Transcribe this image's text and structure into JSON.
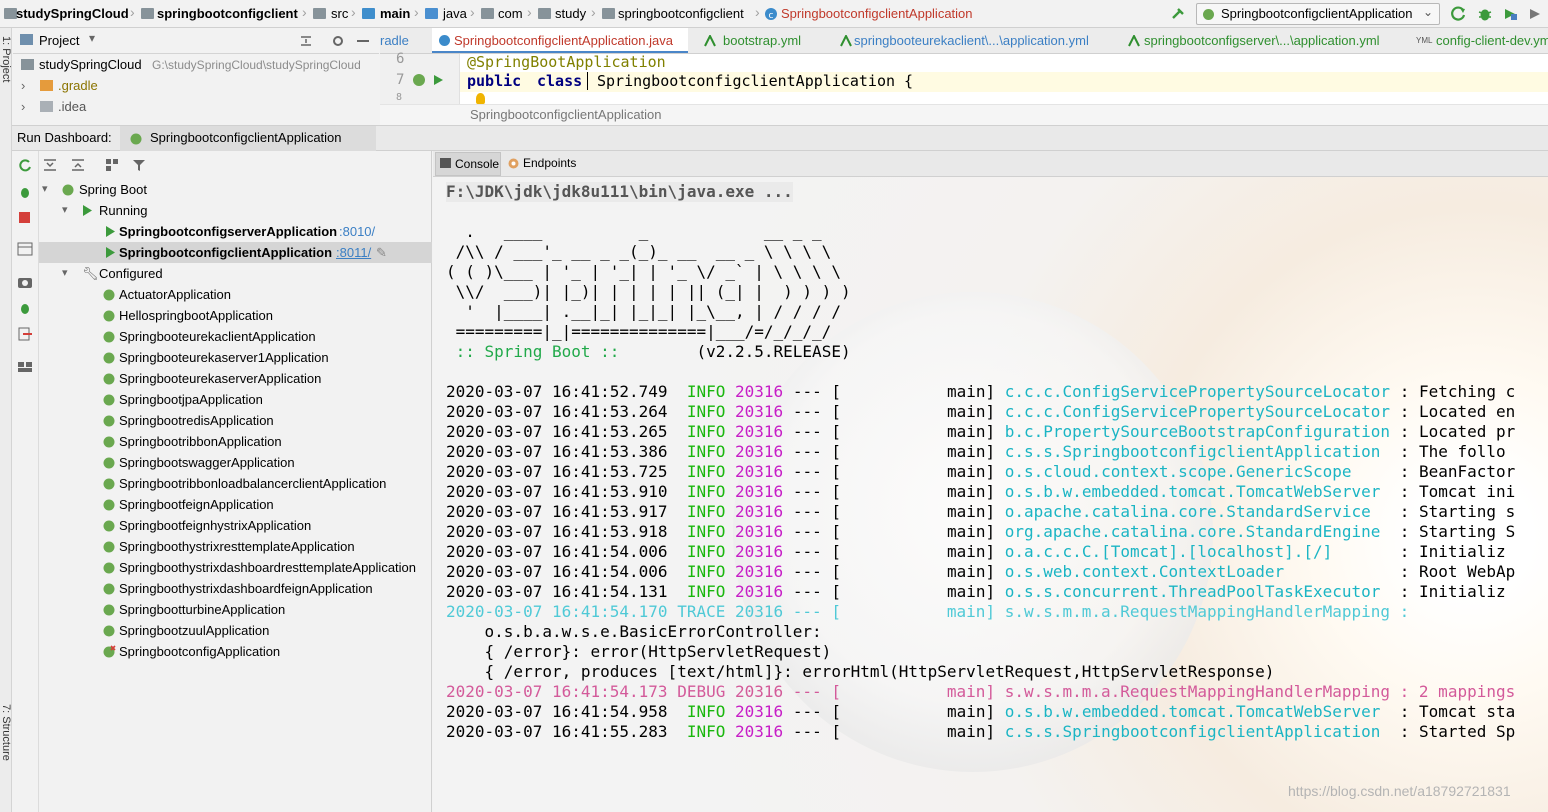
{
  "navbar": {
    "crumbs": [
      "studySpringCloud",
      "springbootconfigclient",
      "src",
      "main",
      "java",
      "com",
      "study",
      "springbootconfigclient",
      "SpringbootconfigclientApplication"
    ],
    "run_config": "SpringbootconfigclientApplication"
  },
  "side_stripe": {
    "top": "1: Project",
    "bottom": "7: Structure"
  },
  "project_panel": {
    "title": "Project",
    "root_name": "studySpringCloud",
    "root_path": "G:\\studySpringCloud\\studySpringCloud",
    "items": [
      ".gradle",
      ".idea"
    ]
  },
  "editor_tabs": [
    {
      "label": "radle",
      "active": false
    },
    {
      "label": "SpringbootconfigclientApplication.java",
      "active": true
    },
    {
      "label": "bootstrap.yml",
      "active": false
    },
    {
      "label": "springbooteurekaclient\\...\\application.yml",
      "active": false
    },
    {
      "label": "springbootconfigserver\\...\\application.yml",
      "active": false
    },
    {
      "label": "config-client-dev.yml",
      "active": false
    }
  ],
  "editor": {
    "line_numbers": [
      "6",
      "7",
      "8"
    ],
    "line6": "@SpringBootApplication",
    "kw_public": "public",
    "kw_class": "class",
    "class_decl": "SpringbootconfigclientApplication {",
    "breadcrumb": "SpringbootconfigclientApplication"
  },
  "run_dashboard": {
    "title": "Run Dashboard:",
    "tab": "SpringbootconfigclientApplication",
    "console_tab": "Console",
    "endpoints_tab": "Endpoints",
    "tree": {
      "root": "Spring Boot",
      "running_label": "Running",
      "running": [
        {
          "name": "SpringbootconfigserverApplication",
          "port": ":8010/"
        },
        {
          "name": "SpringbootconfigclientApplication",
          "port": ":8011/"
        }
      ],
      "configured_label": "Configured",
      "configured": [
        "ActuatorApplication",
        "HellospringbootApplication",
        "SpringbooteurekaclientApplication",
        "Springbooteurekaserver1Application",
        "SpringbooteurekaserverApplication",
        "SpringbootjpaApplication",
        "SpringbootredisApplication",
        "SpringbootribbonApplication",
        "SpringbootswaggerApplication",
        "SpringbootribbonloadbalancerclientApplication",
        "SpringbootfeignApplication",
        "SpringbootfeignhystrixApplication",
        "SpringboothystrixresttemplateApplication",
        "SpringboothystrixdashboardresttemplateApplication",
        "SpringboothystrixdashboardfeignApplication",
        "SpringbootturbineApplication",
        "SpringbootzuulApplication",
        "SpringbootconfigApplication"
      ]
    }
  },
  "console": {
    "cmd": "F:\\JDK\\jdk\\jdk8u111\\bin\\java.exe ...",
    "banner": [
      "  .   ____          _            __ _ _",
      " /\\\\ / ___'_ __ _ _(_)_ __  __ _ \\ \\ \\ \\",
      "( ( )\\___ | '_ | '_| | '_ \\/ _` | \\ \\ \\ \\",
      " \\\\/  ___)| |_)| | | | | || (_| |  ) ) ) )",
      "  '  |____| .__|_| |_|_| |_\\__, | / / / /",
      " =========|_|==============|___/=/_/_/_/"
    ],
    "spring_boot_label": " :: Spring Boot :: ",
    "spring_boot_version": "       (v2.2.5.RELEASE)",
    "logs": [
      {
        "ts": "2020-03-07 16:41:52.749",
        "level": " INFO",
        "pid": "20316",
        "sep": " --- [           main] ",
        "logger": "c.c.c.ConfigServicePropertySourceLocator",
        "msg": " : Fetching c"
      },
      {
        "ts": "2020-03-07 16:41:53.264",
        "level": " INFO",
        "pid": "20316",
        "sep": " --- [           main] ",
        "logger": "c.c.c.ConfigServicePropertySourceLocator",
        "msg": " : Located en"
      },
      {
        "ts": "2020-03-07 16:41:53.265",
        "level": " INFO",
        "pid": "20316",
        "sep": " --- [           main] ",
        "logger": "b.c.PropertySourceBootstrapConfiguration",
        "msg": " : Located pr"
      },
      {
        "ts": "2020-03-07 16:41:53.386",
        "level": " INFO",
        "pid": "20316",
        "sep": " --- [           main] ",
        "logger": "c.s.s.SpringbootconfigclientApplication",
        "msg": "  : The follo"
      },
      {
        "ts": "2020-03-07 16:41:53.725",
        "level": " INFO",
        "pid": "20316",
        "sep": " --- [           main] ",
        "logger": "o.s.cloud.context.scope.GenericScope",
        "msg": "     : BeanFactor"
      },
      {
        "ts": "2020-03-07 16:41:53.910",
        "level": " INFO",
        "pid": "20316",
        "sep": " --- [           main] ",
        "logger": "o.s.b.w.embedded.tomcat.TomcatWebServer",
        "msg": "  : Tomcat ini"
      },
      {
        "ts": "2020-03-07 16:41:53.917",
        "level": " INFO",
        "pid": "20316",
        "sep": " --- [           main] ",
        "logger": "o.apache.catalina.core.StandardService",
        "msg": "   : Starting s"
      },
      {
        "ts": "2020-03-07 16:41:53.918",
        "level": " INFO",
        "pid": "20316",
        "sep": " --- [           main] ",
        "logger": "org.apache.catalina.core.StandardEngine",
        "msg": "  : Starting S"
      },
      {
        "ts": "2020-03-07 16:41:54.006",
        "level": " INFO",
        "pid": "20316",
        "sep": " --- [           main] ",
        "logger": "o.a.c.c.C.[Tomcat].[localhost].[/]",
        "msg": "       : Initializ"
      },
      {
        "ts": "2020-03-07 16:41:54.006",
        "level": " INFO",
        "pid": "20316",
        "sep": " --- [           main] ",
        "logger": "o.s.web.context.ContextLoader",
        "msg": "            : Root WebAp"
      },
      {
        "ts": "2020-03-07 16:41:54.131",
        "level": " INFO",
        "pid": "20316",
        "sep": " --- [           main] ",
        "logger": "o.s.s.concurrent.ThreadPoolTaskExecutor",
        "msg": "  : Initializ"
      }
    ],
    "trace_line": "2020-03-07 16:41:54.170 TRACE 20316 --- [           main] s.w.s.m.m.a.RequestMappingHandlerMapping : ",
    "trace_details": [
      "    o.s.b.a.w.s.e.BasicErrorController:",
      "    { /error}: error(HttpServletRequest)",
      "    { /error, produces [text/html]}: errorHtml(HttpServletRequest,HttpServletResponse)"
    ],
    "debug_line": "2020-03-07 16:41:54.173 DEBUG 20316 --- [           main] s.w.s.m.m.a.RequestMappingHandlerMapping : 2 mappings",
    "logs2": [
      {
        "ts": "2020-03-07 16:41:54.958",
        "level": " INFO",
        "pid": "20316",
        "sep": " --- [           main] ",
        "logger": "o.s.b.w.embedded.tomcat.TomcatWebServer",
        "msg": "  : Tomcat sta"
      },
      {
        "ts": "2020-03-07 16:41:55.283",
        "level": " INFO",
        "pid": "20316",
        "sep": " --- [           main] ",
        "logger": "c.s.s.SpringbootconfigclientApplication",
        "msg": "  : Started Sp"
      }
    ]
  },
  "watermark": "https://blog.csdn.net/a18792721831"
}
